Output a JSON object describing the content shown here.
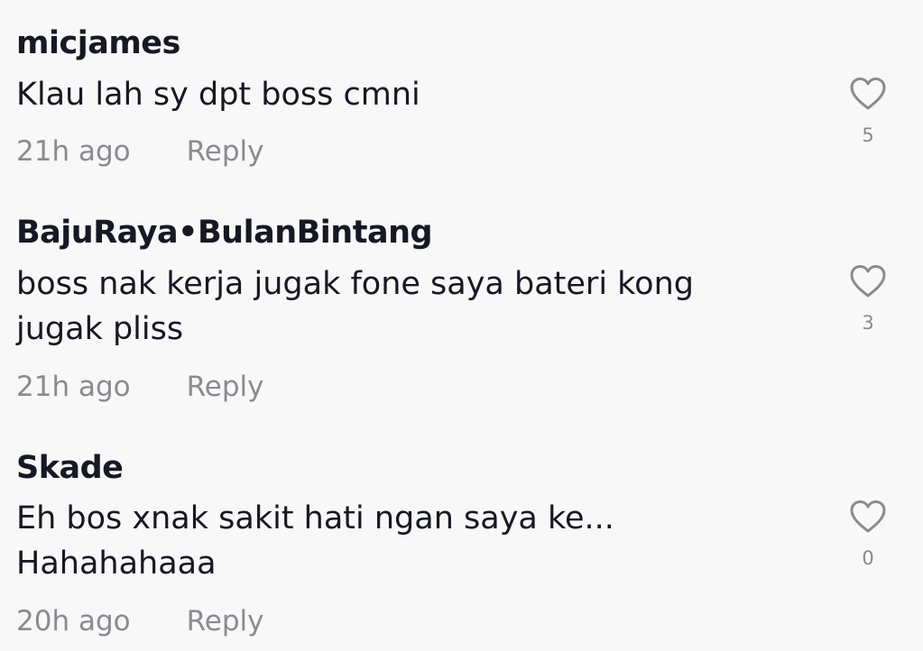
{
  "comments": [
    {
      "username": "micjames",
      "text_lines": [
        "Klau lah sy dpt boss cmni"
      ],
      "time": "21h ago",
      "reply_label": "Reply",
      "likes": "5"
    },
    {
      "username": "BajuRaya•BulanBintang",
      "text_lines": [
        "boss nak kerja jugak fone saya bateri kong",
        "jugak pliss"
      ],
      "time": "21h ago",
      "reply_label": "Reply",
      "likes": "3"
    },
    {
      "username": "Skade",
      "text_lines": [
        "Eh bos xnak sakit hati ngan saya ke...",
        "Hahahahaaa"
      ],
      "time": "20h ago",
      "reply_label": "Reply",
      "likes": "0"
    }
  ],
  "colors": {
    "background": "#f8f8f8",
    "text": "#161823",
    "muted": "#8a8b91"
  },
  "icons": {
    "like": "heart-outline-icon"
  }
}
